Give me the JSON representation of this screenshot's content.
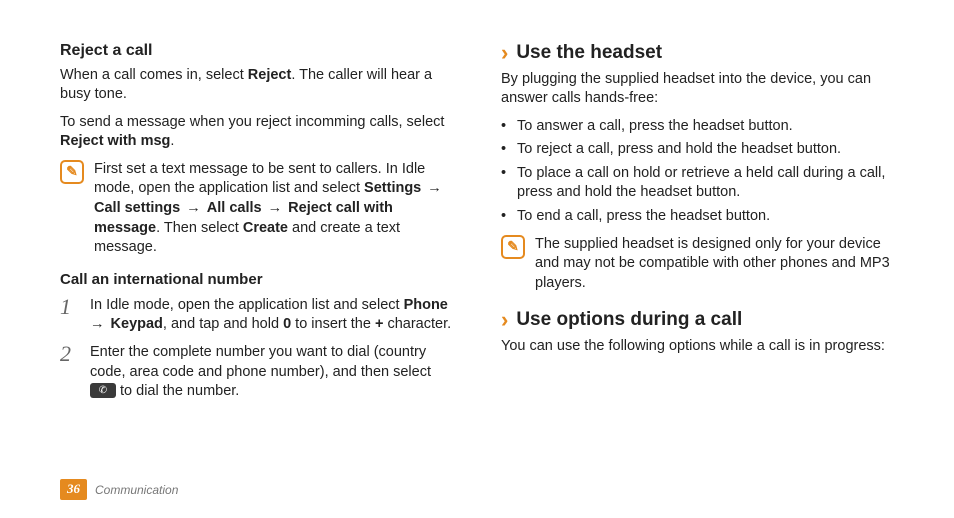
{
  "left": {
    "rejectHeading": "Reject a call",
    "rejectPara1_a": "When a call comes in, select ",
    "rejectPara1_b": "Reject",
    "rejectPara1_c": ". The caller will hear a busy tone.",
    "rejectPara2_a": "To send a message when you reject incomming calls, select ",
    "rejectPara2_b": "Reject with msg",
    "rejectPara2_c": ".",
    "note1_a": "First set a text message to be sent to callers. In Idle mode, open the application list and select ",
    "note1_b": "Settings",
    "note1_arrow": " → ",
    "note1_c": "Call settings",
    "note1_d": "All calls",
    "note1_e": "Reject call with message",
    "note1_f": ". Then select ",
    "note1_g": "Create",
    "note1_h": " and create a text message.",
    "intlHeading": "Call an international number",
    "step1num": "1",
    "step1_a": "In Idle mode, open the application list and select ",
    "step1_b": "Phone",
    "step1_c": "Keypad",
    "step1_d": ", and tap and hold ",
    "step1_e": "0",
    "step1_f": " to insert the ",
    "step1_g": "+",
    "step1_h": " character.",
    "step2num": "2",
    "step2_a": "Enter the complete number you want to dial (country code, area code and phone number), and then select ",
    "step2_b": " to dial the number."
  },
  "right": {
    "headsetHeading": "Use the headset",
    "headsetIntro": "By plugging the supplied headset into the device, you can answer calls hands-free:",
    "bullets": [
      "To answer a call, press the headset button.",
      "To reject a call, press and hold the headset button.",
      "To place a call on hold or retrieve a held call during a call, press and hold the headset button.",
      "To end a call, press the headset button."
    ],
    "note2": "The supplied headset is designed only for your device and may not be compatible with other phones and MP3 players.",
    "optionsHeading": "Use options during a call",
    "optionsIntro": "You can use the following options while a call is in progress:"
  },
  "footer": {
    "page": "36",
    "section": "Communication"
  },
  "glyphs": {
    "chevron": "›",
    "noteIcon": "✎",
    "phone": "✆"
  }
}
